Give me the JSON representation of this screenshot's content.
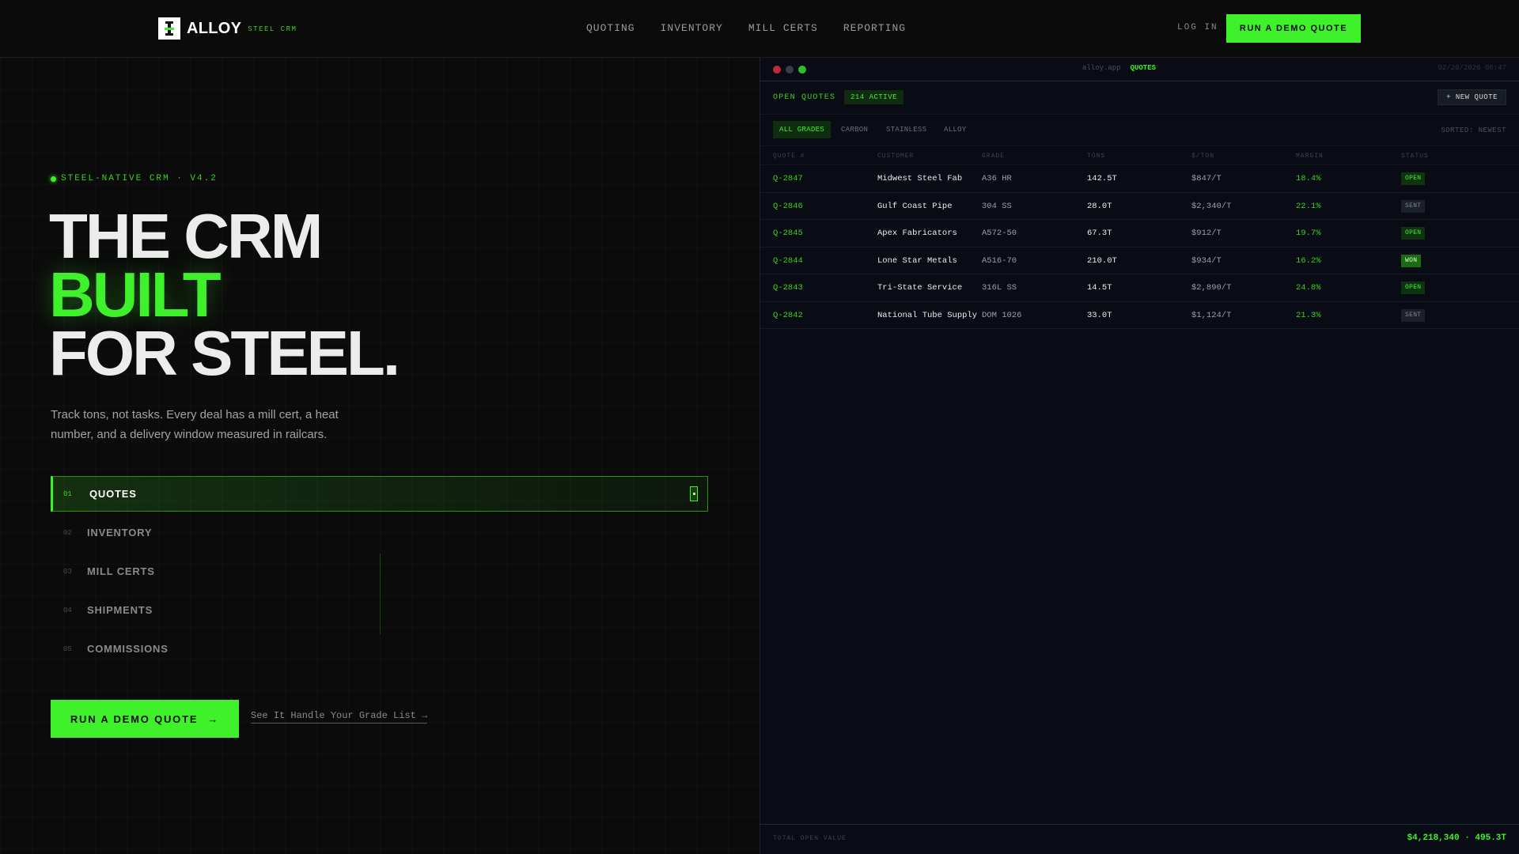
{
  "brand": {
    "name": "ALLOY",
    "tagline": "STEEL CRM"
  },
  "nav": {
    "links": [
      "QUOTING",
      "INVENTORY",
      "MILL CERTS",
      "REPORTING"
    ],
    "login": "LOG IN",
    "cta": "RUN A DEMO QUOTE"
  },
  "hero": {
    "eyebrow": "STEEL-NATIVE CRM · V4.2",
    "line1": "THE CRM",
    "line2": "BUILT",
    "line3": "FOR STEEL.",
    "subcopy": "Track tons, not tasks. Every deal has a mill cert, a heat number, and a delivery window measured in railcars.",
    "features": [
      {
        "num": "01",
        "label": "QUOTES"
      },
      {
        "num": "02",
        "label": "INVENTORY"
      },
      {
        "num": "03",
        "label": "MILL CERTS"
      },
      {
        "num": "04",
        "label": "SHIPMENTS"
      },
      {
        "num": "05",
        "label": "COMMISSIONS"
      }
    ],
    "cta": "RUN A DEMO QUOTE",
    "cta_arrow": "→",
    "link": "See It Handle Your Grade List →"
  },
  "app": {
    "breadcrumb_host": "alloy.app",
    "breadcrumb_page": "QUOTES",
    "timestamp": "02/20/2026 06:47",
    "title": "OPEN QUOTES",
    "badge": "214 ACTIVE",
    "new_quote": "+ NEW QUOTE",
    "filters": [
      "ALL GRADES",
      "CARBON",
      "STAINLESS",
      "ALLOY"
    ],
    "sorted": "SORTED: NEWEST",
    "columns": [
      "QUOTE #",
      "CUSTOMER",
      "GRADE",
      "TONS",
      "$/TON",
      "MARGIN",
      "STATUS"
    ],
    "rows": [
      {
        "id": "Q-2847",
        "customer": "Midwest Steel Fab",
        "grade": "A36 HR",
        "tons": "142.5T",
        "price": "$847/T",
        "margin": "18.4%",
        "status": "OPEN"
      },
      {
        "id": "Q-2846",
        "customer": "Gulf Coast Pipe",
        "grade": "304 SS",
        "tons": "28.0T",
        "price": "$2,340/T",
        "margin": "22.1%",
        "status": "SENT"
      },
      {
        "id": "Q-2845",
        "customer": "Apex Fabricators",
        "grade": "A572-50",
        "tons": "67.3T",
        "price": "$912/T",
        "margin": "19.7%",
        "status": "OPEN"
      },
      {
        "id": "Q-2844",
        "customer": "Lone Star Metals",
        "grade": "A516-70",
        "tons": "210.0T",
        "price": "$934/T",
        "margin": "16.2%",
        "status": "WON"
      },
      {
        "id": "Q-2843",
        "customer": "Tri-State Service",
        "grade": "316L SS",
        "tons": "14.5T",
        "price": "$2,890/T",
        "margin": "24.8%",
        "status": "OPEN"
      },
      {
        "id": "Q-2842",
        "customer": "National Tube Supply",
        "grade": "DOM 1026",
        "tons": "33.0T",
        "price": "$1,124/T",
        "margin": "21.3%",
        "status": "SENT"
      }
    ],
    "footer_label": "TOTAL OPEN VALUE",
    "footer_value": "$4,218,340 · 495.3T"
  },
  "colors": {
    "accent": "#3ef12a",
    "background": "#0b0b0b",
    "panel": "#090c14"
  }
}
